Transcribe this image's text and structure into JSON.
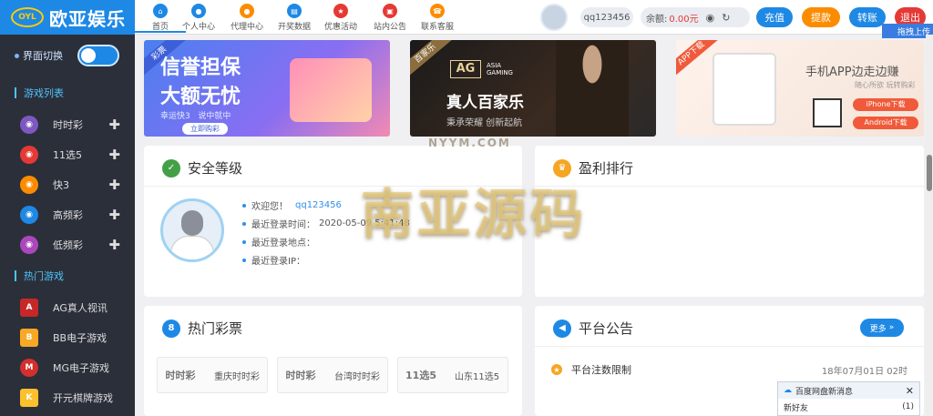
{
  "brand": {
    "logo_badge": "OYL",
    "name": "欧亚娱乐",
    "accent": "#1e88e5"
  },
  "sidebar": {
    "toggle_label": "界面切换",
    "sections": [
      {
        "title": "游戏列表",
        "items": [
          {
            "label": "时时彩",
            "icon": "ssc-icon",
            "color": "#7e57c2"
          },
          {
            "label": "11选5",
            "icon": "11x5-icon",
            "color": "#e53935"
          },
          {
            "label": "快3",
            "icon": "k3-icon",
            "color": "#fb8c00"
          },
          {
            "label": "高频彩",
            "icon": "gpc-icon",
            "color": "#1e88e5"
          },
          {
            "label": "低频彩",
            "icon": "dpc-icon",
            "color": "#ab47bc"
          }
        ]
      },
      {
        "title": "热门游戏",
        "items": [
          {
            "label": "AG真人视讯",
            "icon": "ag-icon",
            "color": "#c62828"
          },
          {
            "label": "BB电子游戏",
            "icon": "bb-icon",
            "color": "#f9a825"
          },
          {
            "label": "MG电子游戏",
            "icon": "mg-icon",
            "color": "#d32f2f"
          },
          {
            "label": "开元棋牌游戏",
            "icon": "ky-icon",
            "color": "#fbc02d"
          }
        ]
      }
    ]
  },
  "nav": [
    {
      "label": "首页",
      "icon": "home-icon",
      "color": "#1e88e5"
    },
    {
      "label": "个人中心",
      "icon": "user-icon",
      "color": "#1e88e5"
    },
    {
      "label": "代理中心",
      "icon": "agent-icon",
      "color": "#fb8c00"
    },
    {
      "label": "开奖数据",
      "icon": "lottery-data-icon",
      "color": "#1e88e5"
    },
    {
      "label": "优惠活动",
      "icon": "promo-icon",
      "color": "#e53935"
    },
    {
      "label": "站内公告",
      "icon": "notice-icon",
      "color": "#e53935"
    },
    {
      "label": "联系客服",
      "icon": "service-icon",
      "color": "#fb8c00"
    }
  ],
  "account": {
    "username": "qq123456",
    "balance_label": "余额:",
    "balance_value": "0.00元",
    "buttons": {
      "deposit": "充值",
      "withdraw": "提款",
      "transfer": "转账",
      "logout": "退出"
    },
    "upload_tag": "拖拽上传"
  },
  "banners": [
    {
      "ribbon": "彩票",
      "headline1": "信誉担保",
      "headline2": "大额无忧",
      "caption1": "幸运快3",
      "caption2": "说中就中",
      "cta": "立即购彩"
    },
    {
      "ribbon": "百家乐",
      "brand": "AG",
      "brand_sub": "ASIA GAMING",
      "headline": "真人百家乐",
      "caption": "秉承荣耀 创新起航"
    },
    {
      "ribbon": "APP下载",
      "headline": "手机APP边走边赚",
      "caption": "随心所欲 玩转购彩",
      "ios": "iPhone下载",
      "android": "Android下载"
    }
  ],
  "security": {
    "title": "安全等级",
    "welcome_label": "欢迎您！",
    "username": "qq123456",
    "last_login_time_label": "最近登录时间：",
    "last_login_time": "2020-05-09 5:41:48",
    "last_login_place_label": "最近登录地点：",
    "last_login_ip_label": "最近登录IP："
  },
  "profit_rank": {
    "title": "盈利排行"
  },
  "hot_lottery": {
    "title": "热门彩票",
    "cards": [
      {
        "logo": "时时彩",
        "name": "重庆时时彩"
      },
      {
        "logo": "时时彩",
        "name": "台湾时时彩"
      },
      {
        "logo": "11选5",
        "name": "山东11选5"
      }
    ]
  },
  "announcements": {
    "title": "平台公告",
    "more": "更多",
    "items": [
      {
        "title": "平台注数限制",
        "date": "18年07月01日 02时"
      }
    ]
  },
  "watermark": {
    "text": "南亚源码",
    "url": "NYYM.COM"
  },
  "popup": {
    "title": "百度网盘新消息",
    "item": "新好友",
    "count": "(1)"
  }
}
